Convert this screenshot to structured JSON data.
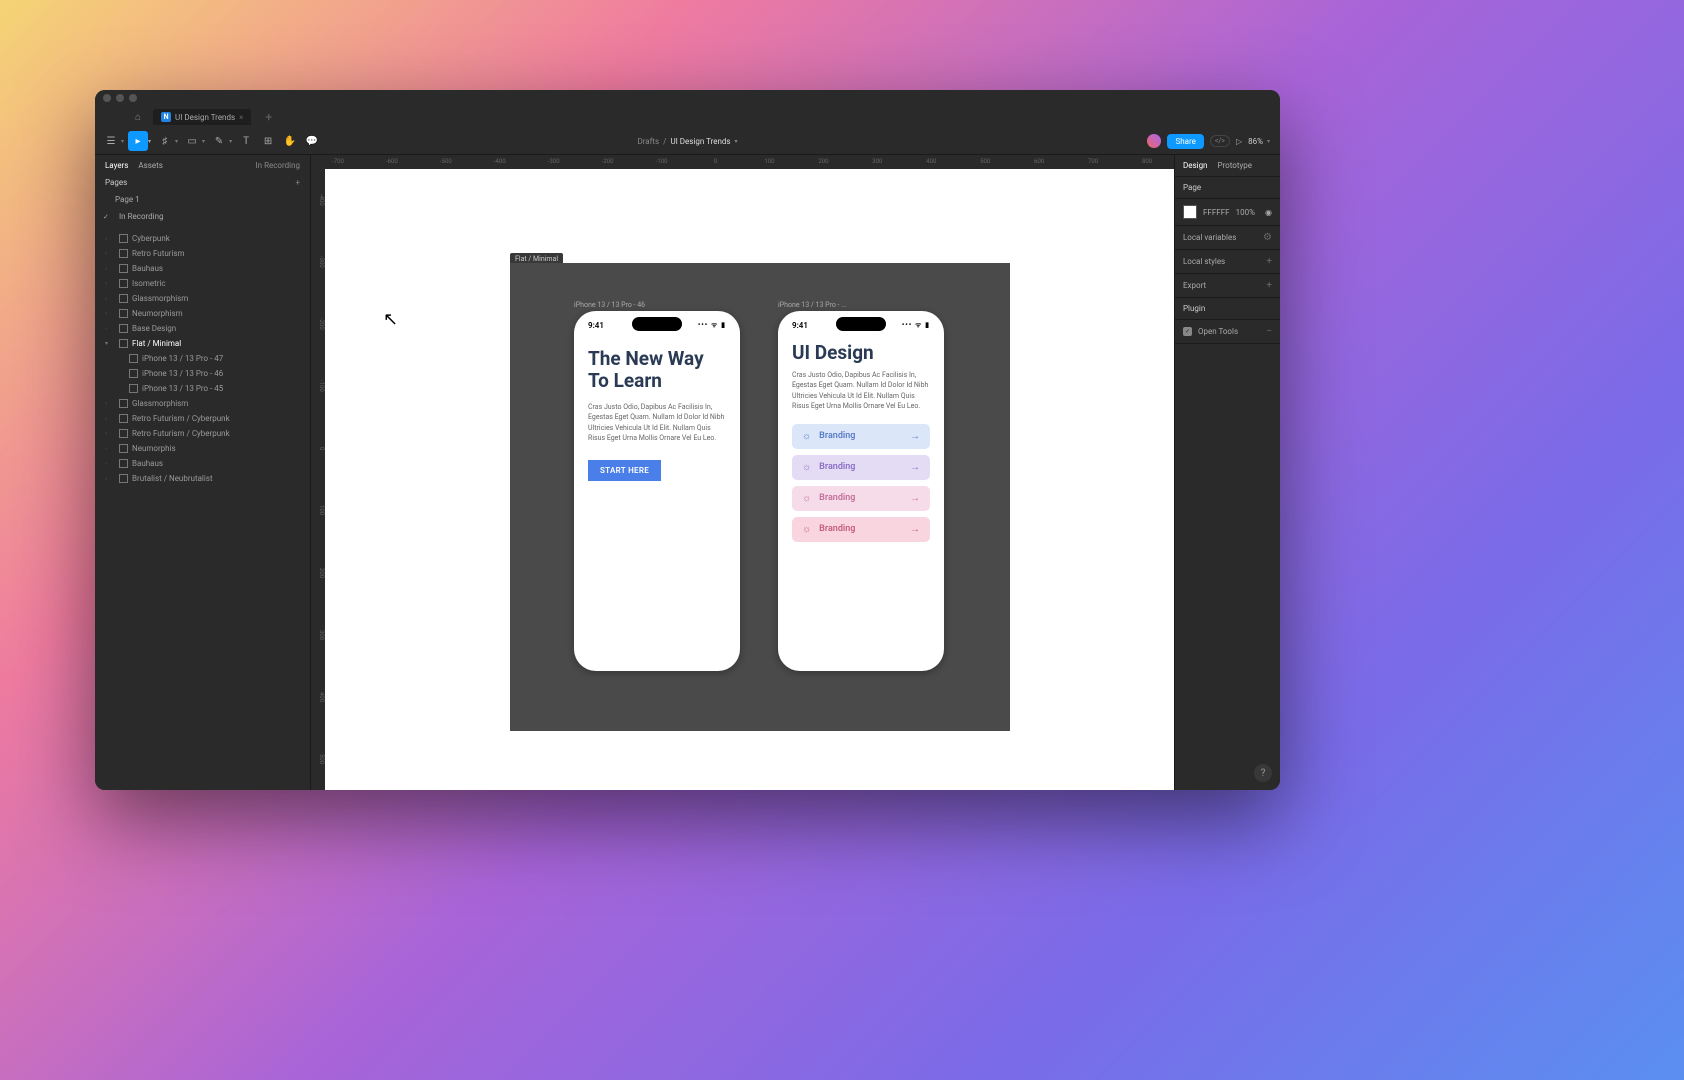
{
  "tab": {
    "title": "UI Design Trends",
    "icon_letter": "N"
  },
  "breadcrumbs": {
    "parent": "Drafts",
    "current": "UI Design Trends"
  },
  "toolbar": {
    "zoom": "86%",
    "share_label": "Share"
  },
  "left_panel": {
    "tabs": [
      "Layers",
      "Assets"
    ],
    "recording_label": "In Recording",
    "pages_label": "Pages",
    "pages": [
      "Page 1",
      "In Recording"
    ],
    "layers": [
      "Cyberpunk",
      "Retro Futurism",
      "Bauhaus",
      "Isometric",
      "Glassmorphism",
      "Neumorphism",
      "Base Design",
      "Flat / Minimal"
    ],
    "flat_children": [
      "iPhone 13 / 13 Pro - 47",
      "iPhone 13 / 13 Pro - 46",
      "iPhone 13 / 13 Pro - 45"
    ],
    "layers_after": [
      "Glassmorphism",
      "Retro Futurism / Cyberpunk",
      "Retro Futurism / Cyberpunk",
      "Neumorphis",
      "Bauhaus",
      "Brutalist / Neubrutalist"
    ]
  },
  "ruler_h": [
    "-700",
    "-600",
    "-500",
    "-400",
    "-300",
    "-200",
    "-100",
    "0",
    "100",
    "200",
    "300",
    "400",
    "500",
    "600",
    "700",
    "800"
  ],
  "ruler_v": [
    "-400",
    "-300",
    "-200",
    "-100",
    "0",
    "100",
    "200",
    "300",
    "400",
    "500"
  ],
  "canvas": {
    "artboard_label": "Flat / Minimal",
    "phone1_label": "iPhone 13 / 13 Pro - 46",
    "phone2_label": "iPhone 13 / 13 Pro - ...",
    "status_time": "9:41",
    "phone1": {
      "title": "The New Way To Learn",
      "body": "Cras Justo Odio, Dapibus Ac Facilisis In, Egestas Eget Quam. Nullam Id Dolor Id Nibh Ultricies Vehicula Ut Id Elit. Nullam Quis Risus Eget Urna Mollis Ornare Vel Eu Leo.",
      "cta": "START HERE"
    },
    "phone2": {
      "title": "UI Design",
      "body": "Cras Justo Odio, Dapibus Ac Facilisis In, Egestas Eget Quam. Nullam Id Dolor Id Nibh Ultricies Vehicula Ut Id Elit. Nullam Quis Risus Eget Urna Mollis Ornare Vel Eu Leo.",
      "cards": [
        "Branding",
        "Branding",
        "Branding",
        "Branding"
      ]
    }
  },
  "right_panel": {
    "tabs": [
      "Design",
      "Prototype"
    ],
    "page_label": "Page",
    "page_color": "FFFFFF",
    "page_pct": "100%",
    "local_vars": "Local variables",
    "local_styles": "Local styles",
    "export": "Export",
    "plugin": "Plugin",
    "plugin_item": "Open Tools"
  }
}
